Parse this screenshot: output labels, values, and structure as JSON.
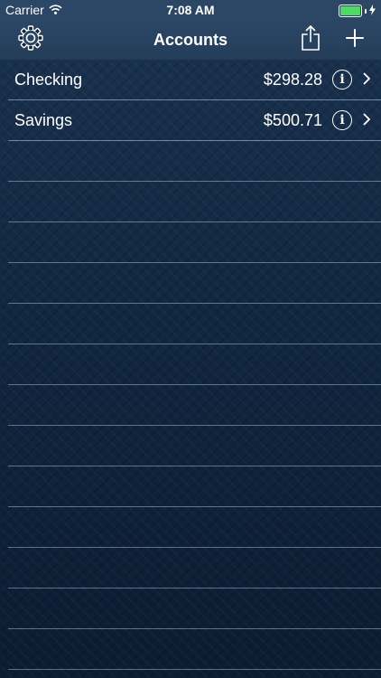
{
  "status_bar": {
    "carrier": "Carrier",
    "time": "7:08 AM",
    "battery_color": "#4cd964"
  },
  "nav": {
    "title": "Accounts",
    "left_icon": "gear-icon",
    "right_icons": [
      "share-icon",
      "plus-icon"
    ]
  },
  "accounts": [
    {
      "name": "Checking",
      "balance": "$298.28"
    },
    {
      "name": "Savings",
      "balance": "$500.71"
    }
  ],
  "colors": {
    "background": "#10223b",
    "nav_bar": "#2b4765",
    "separator": "#bed7f0"
  }
}
